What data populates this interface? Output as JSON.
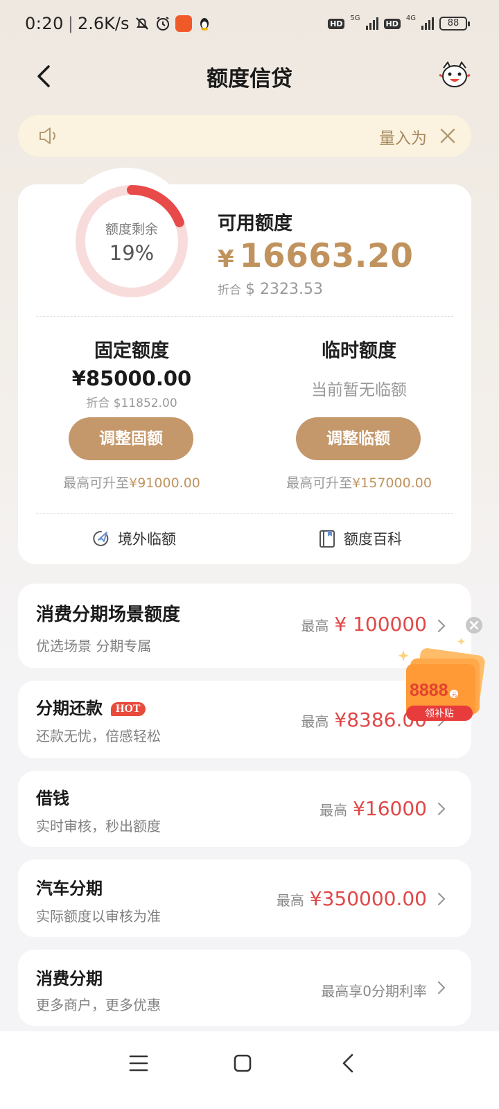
{
  "status_bar": {
    "time": "0:20",
    "speed": "2.6K/s",
    "net1": "5G",
    "net2": "4G",
    "hd": "HD",
    "battery": "88"
  },
  "nav": {
    "title": "额度信贷"
  },
  "notice": {
    "text": "量入为"
  },
  "credit": {
    "gauge_label": "额度剩余",
    "gauge_pct_text": "19%",
    "gauge_fraction": 0.19,
    "available_label": "可用额度",
    "available_currency": "¥",
    "available_amount": "16663.20",
    "converted_prefix": "折合",
    "converted_value": "$ 2323.53"
  },
  "fixed": {
    "title": "固定额度",
    "amount": "¥85000.00",
    "converted": "折合 $11852.00",
    "button": "调整固额",
    "upto_prefix": "最高可升至",
    "upto_value": "¥91000.00"
  },
  "temporary": {
    "title": "临时额度",
    "status": "当前暂无临额",
    "button": "调整临额",
    "upto_prefix": "最高可升至",
    "upto_value": "¥157000.00"
  },
  "quick_links": [
    {
      "label": "境外临额",
      "icon": "plane-globe-icon"
    },
    {
      "label": "额度百科",
      "icon": "book-icon"
    }
  ],
  "rows": [
    {
      "title": "消费分期场景额度",
      "subtitle": "优选场景 分期专属",
      "prefix": "最高",
      "amount": "¥ 100000"
    },
    {
      "title": "分期还款",
      "badge": "HOT",
      "subtitle": "还款无忧，倍感轻松",
      "prefix": "最高",
      "amount": "¥8386.00"
    },
    {
      "title": "借钱",
      "subtitle": "实时审核，秒出额度",
      "prefix": "最高",
      "amount": "¥16000"
    },
    {
      "title": "汽车分期",
      "subtitle": "实际额度以审核为准",
      "prefix": "最高",
      "amount": "¥350000.00"
    },
    {
      "title": "消费分期",
      "subtitle": "更多商户，更多优惠",
      "text": "最高享0分期利率"
    }
  ],
  "promo": {
    "amount": "8888",
    "unit": "元",
    "label": "领补贴"
  },
  "colors": {
    "gold": "#c0935e",
    "button": "#c4986b",
    "red": "#e04848",
    "notice_bg": "#fbf3df"
  }
}
